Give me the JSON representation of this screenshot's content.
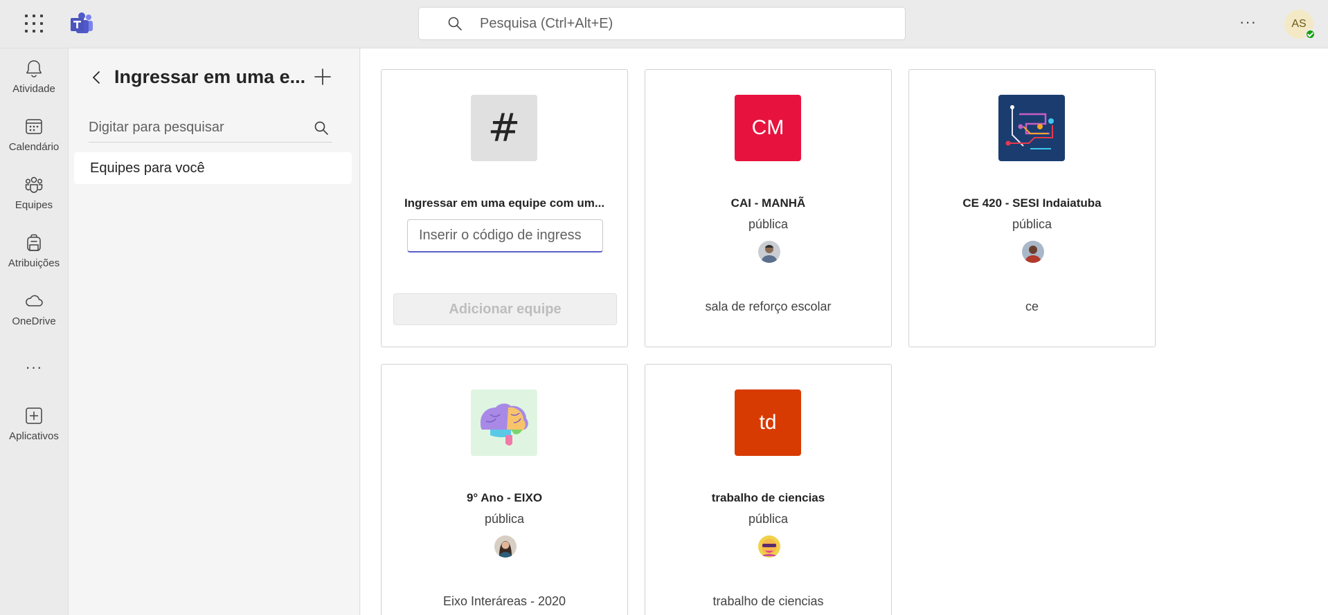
{
  "topbar": {
    "search_placeholder": "Pesquisa (Ctrl+Alt+E)",
    "more_label": "···",
    "avatar_initials": "AS"
  },
  "rail": {
    "items": [
      {
        "label": "Atividade",
        "icon": "bell-icon"
      },
      {
        "label": "Calendário",
        "icon": "calendar-icon"
      },
      {
        "label": "Equipes",
        "icon": "teams-icon"
      },
      {
        "label": "Atribuições",
        "icon": "backpack-icon"
      },
      {
        "label": "OneDrive",
        "icon": "cloud-icon"
      },
      {
        "label": "Aplicativos",
        "icon": "add-square-icon"
      }
    ],
    "more_label": "···"
  },
  "panel": {
    "title": "Ingressar em uma e...",
    "search_placeholder": "Digitar para pesquisar",
    "items": [
      {
        "label": "Equipes para você"
      }
    ]
  },
  "join_card": {
    "symbol": "#",
    "title": "Ingressar em uma equipe com um...",
    "code_placeholder": "Inserir o código de ingress",
    "button_label": "Adicionar equipe"
  },
  "team_cards": [
    {
      "name": "CAI - MANHÃ",
      "visibility": "pública",
      "description": "sala de reforço escolar",
      "thumb_text": "CM",
      "thumb_color": "#e8123e"
    },
    {
      "name": "CE 420 - SESI Indaiatuba",
      "visibility": "pública",
      "description": "ce",
      "thumb_text": "",
      "thumb_color": "#1b3c6e"
    },
    {
      "name": "9° Ano - EIXO",
      "visibility": "pública",
      "description": "Eixo Interáreas - 2020",
      "thumb_text": "",
      "thumb_color": "#dff5e1"
    },
    {
      "name": "trabalho de ciencias",
      "visibility": "pública",
      "description": "trabalho de ciencias",
      "thumb_text": "td",
      "thumb_color": "#d83b01"
    }
  ],
  "colors": {
    "accent": "#5b5fc7",
    "presence_available": "#13a10e"
  }
}
